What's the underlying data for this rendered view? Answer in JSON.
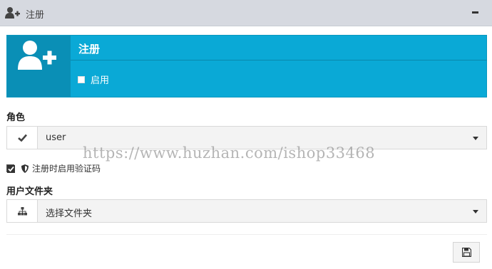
{
  "header": {
    "icon": "user-plus-icon",
    "title": "注册",
    "collapse_icon": "minus-icon"
  },
  "banner": {
    "icon": "user-plus-icon",
    "title": "注册",
    "enable_label": "启用",
    "enable_checked": false,
    "color": "#0aa9d6"
  },
  "role": {
    "label": "角色",
    "addon_icon": "check-icon",
    "value": "user"
  },
  "captcha": {
    "checked": true,
    "icon": "shield-icon",
    "label": "注册时启用验证码"
  },
  "folder": {
    "label": "用户文件夹",
    "addon_icon": "sitemap-icon",
    "value": "选择文件夹"
  },
  "footer": {
    "save_icon": "save-icon"
  },
  "watermark": "https://www.huzhan.com/ishop33468"
}
